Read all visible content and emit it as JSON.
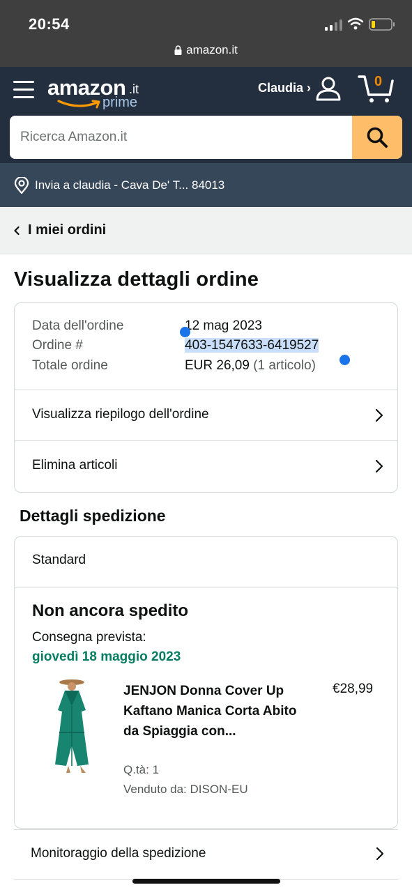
{
  "status_bar": {
    "time": "20:54",
    "url": "amazon.it"
  },
  "header": {
    "logo_word": "amazon",
    "logo_tld": ".it",
    "logo_prime": "prime",
    "user_label": "Claudia ›",
    "cart_count": "0",
    "search_placeholder": "Ricerca Amazon.it"
  },
  "deliver_to": "Invia a claudia - Cava De' T... 84013",
  "breadcrumb": "I miei ordini",
  "page_title": "Visualizza dettagli ordine",
  "order": {
    "date_label": "Data dell'ordine",
    "date_value": "12 mag 2023",
    "number_label": "Ordine #",
    "number_value": "403-1547633-6419527",
    "total_label": "Totale ordine",
    "total_value": "EUR 26,09",
    "total_items": "(1 articolo)",
    "summary_link": "Visualizza riepilogo dell'ordine",
    "delete_link": "Elimina articoli"
  },
  "shipping": {
    "section_title": "Dettagli spedizione",
    "type": "Standard",
    "status": "Non ancora spedito",
    "eta_label": "Consegna prevista:",
    "eta_date": "giovedì 18 maggio 2023",
    "product": {
      "title": "JENJON Donna Cover Up Kaftano Manica Corta Abito da Spiaggia con...",
      "price": "€28,99",
      "qty": "Q.tà: 1",
      "seller": "Venduto da: DISON-EU"
    },
    "tracking_link": "Monitoraggio della spedizione"
  },
  "colors": {
    "header_bg": "#232f3e",
    "deliver_bg": "#37475a",
    "search_button": "#febd69",
    "eta_green": "#067d62",
    "selection": "#c9defa",
    "selection_handle": "#1a73e8"
  },
  "icons": [
    "signal-icon",
    "wifi-icon",
    "battery-icon",
    "lock-icon",
    "menu-icon",
    "user-icon",
    "cart-icon",
    "search-icon",
    "location-pin-icon",
    "chevron-left-icon",
    "chevron-right-icon"
  ]
}
